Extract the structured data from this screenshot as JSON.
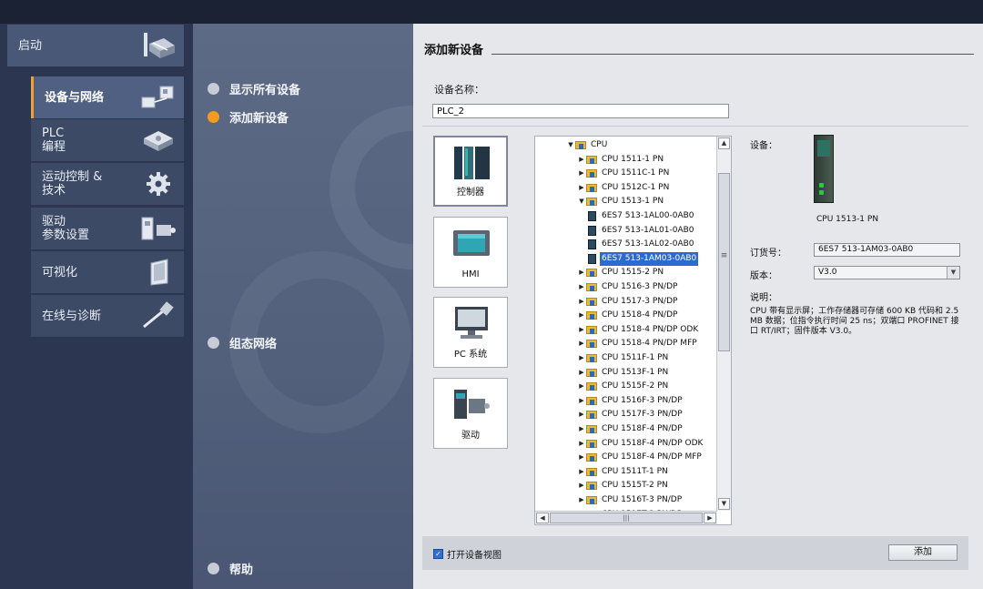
{
  "portal": {
    "start_label": "启动",
    "items": [
      {
        "label": "设备与网络",
        "active": true,
        "icon": "devices-network-icon"
      },
      {
        "label": "PLC\n编程",
        "active": false,
        "icon": "plc-programming-icon"
      },
      {
        "label": "运动控制 &\n技术",
        "active": false,
        "icon": "motion-gear-icon"
      },
      {
        "label": "驱动\n参数设置",
        "active": false,
        "icon": "drive-parameter-icon"
      },
      {
        "label": "可视化",
        "active": false,
        "icon": "visualization-panel-icon"
      },
      {
        "label": "在线与诊断",
        "active": false,
        "icon": "online-diagnostics-icon"
      }
    ]
  },
  "middle": {
    "show_all": "显示所有设备",
    "add_new": "添加新设备",
    "config_network": "组态网络",
    "help": "帮助"
  },
  "dialog": {
    "title": "添加新设备",
    "device_name_label": "设备名称：",
    "device_name_value": "PLC_2",
    "types": [
      {
        "label": "控制器",
        "icon": "controller-icon",
        "selected": true
      },
      {
        "label": "HMI",
        "icon": "hmi-icon",
        "selected": false
      },
      {
        "label": "PC 系统",
        "icon": "pc-system-icon",
        "selected": false
      },
      {
        "label": "驱动",
        "icon": "drive-icon",
        "selected": false
      }
    ],
    "tree": [
      {
        "level": 0,
        "label": "CPU",
        "expanded": true,
        "kind": "folder"
      },
      {
        "level": 1,
        "label": "CPU 1511-1 PN",
        "kind": "folder"
      },
      {
        "level": 1,
        "label": "CPU 1511C-1 PN",
        "kind": "folder"
      },
      {
        "level": 1,
        "label": "CPU 1512C-1 PN",
        "kind": "folder"
      },
      {
        "level": 1,
        "label": "CPU 1513-1 PN",
        "expanded": true,
        "kind": "folder"
      },
      {
        "level": 2,
        "label": "6ES7 513-1AL00-0AB0",
        "kind": "module"
      },
      {
        "level": 2,
        "label": "6ES7 513-1AL01-0AB0",
        "kind": "module"
      },
      {
        "level": 2,
        "label": "6ES7 513-1AL02-0AB0",
        "kind": "module"
      },
      {
        "level": 2,
        "label": "6ES7 513-1AM03-0AB0",
        "kind": "module",
        "selected": true
      },
      {
        "level": 1,
        "label": "CPU 1515-2 PN",
        "kind": "folder"
      },
      {
        "level": 1,
        "label": "CPU 1516-3 PN/DP",
        "kind": "folder"
      },
      {
        "level": 1,
        "label": "CPU 1517-3 PN/DP",
        "kind": "folder"
      },
      {
        "level": 1,
        "label": "CPU 1518-4 PN/DP",
        "kind": "folder"
      },
      {
        "level": 1,
        "label": "CPU 1518-4 PN/DP ODK",
        "kind": "folder"
      },
      {
        "level": 1,
        "label": "CPU 1518-4 PN/DP MFP",
        "kind": "folder"
      },
      {
        "level": 1,
        "label": "CPU 1511F-1 PN",
        "kind": "folder"
      },
      {
        "level": 1,
        "label": "CPU 1513F-1 PN",
        "kind": "folder"
      },
      {
        "level": 1,
        "label": "CPU 1515F-2 PN",
        "kind": "folder"
      },
      {
        "level": 1,
        "label": "CPU 1516F-3 PN/DP",
        "kind": "folder"
      },
      {
        "level": 1,
        "label": "CPU 1517F-3 PN/DP",
        "kind": "folder"
      },
      {
        "level": 1,
        "label": "CPU 1518F-4 PN/DP",
        "kind": "folder"
      },
      {
        "level": 1,
        "label": "CPU 1518F-4 PN/DP ODK",
        "kind": "folder"
      },
      {
        "level": 1,
        "label": "CPU 1518F-4 PN/DP MFP",
        "kind": "folder"
      },
      {
        "level": 1,
        "label": "CPU 1511T-1 PN",
        "kind": "folder"
      },
      {
        "level": 1,
        "label": "CPU 1515T-2 PN",
        "kind": "folder"
      },
      {
        "level": 1,
        "label": "CPU 1516T-3 PN/DP",
        "kind": "folder"
      },
      {
        "level": 1,
        "label": "CPU 1517T-3 PN/DP",
        "kind": "folder"
      }
    ],
    "info": {
      "device_label": "设备：",
      "device_caption": "CPU 1513-1 PN",
      "order_no_label": "订货号：",
      "order_no_value": "6ES7 513-1AM03-0AB0",
      "version_label": "版本：",
      "version_value": "V3.0",
      "desc_label": "说明：",
      "desc_text": "CPU 带有显示屏；工作存储器可存储 600 KB 代码和 2.5 MB 数据；位指令执行时间 25 ns；双端口 PROFINET 接口 RT/IRT；固件版本 V3.0。"
    },
    "open_device_view_label": "打开设备视图",
    "open_device_view_checked": true,
    "add_button": "添加"
  }
}
